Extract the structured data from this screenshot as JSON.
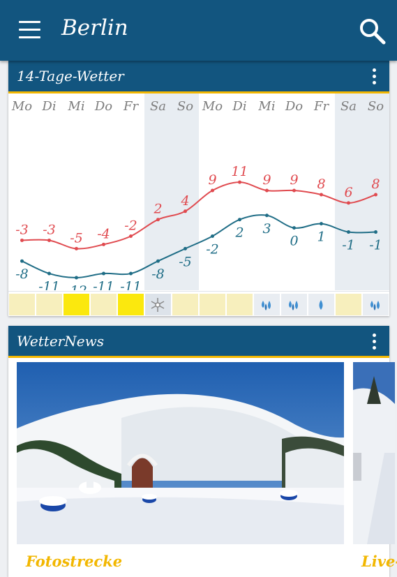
{
  "appbar": {
    "city": "Berlin",
    "menu_icon": "hamburger-menu-icon",
    "search_icon": "search-icon"
  },
  "forecast": {
    "title": "14-Tage-Wetter",
    "days": [
      "Mo",
      "Di",
      "Mi",
      "Do",
      "Fr",
      "Sa",
      "So",
      "Mo",
      "Di",
      "Mi",
      "Do",
      "Fr",
      "Sa",
      "So"
    ],
    "weekend_days": [
      5,
      6,
      12,
      13
    ],
    "high": [
      -3,
      -3,
      -5,
      -4,
      -2,
      2,
      4,
      9,
      11,
      9,
      9,
      8,
      6,
      8
    ],
    "low": [
      -8,
      -11,
      -12,
      -11,
      -11,
      -8,
      -5,
      -2,
      2,
      3,
      0,
      1,
      -1,
      -1
    ],
    "weather": [
      "cloudy",
      "cloudy",
      "sunny",
      "cloudy",
      "sunny",
      "snow",
      "cloudy",
      "cloudy",
      "cloudy",
      "rain-heavy",
      "rain-heavy",
      "rain-light",
      "cloudy",
      "rain-heavy"
    ],
    "colors": {
      "high": "#e04a4f",
      "low": "#1f6d86",
      "accent": "#f2b701",
      "bar": "#12557f"
    }
  },
  "news": {
    "title": "WetterNews",
    "items": [
      {
        "label": "Fotostrecke"
      },
      {
        "label": "Live-"
      }
    ]
  }
}
